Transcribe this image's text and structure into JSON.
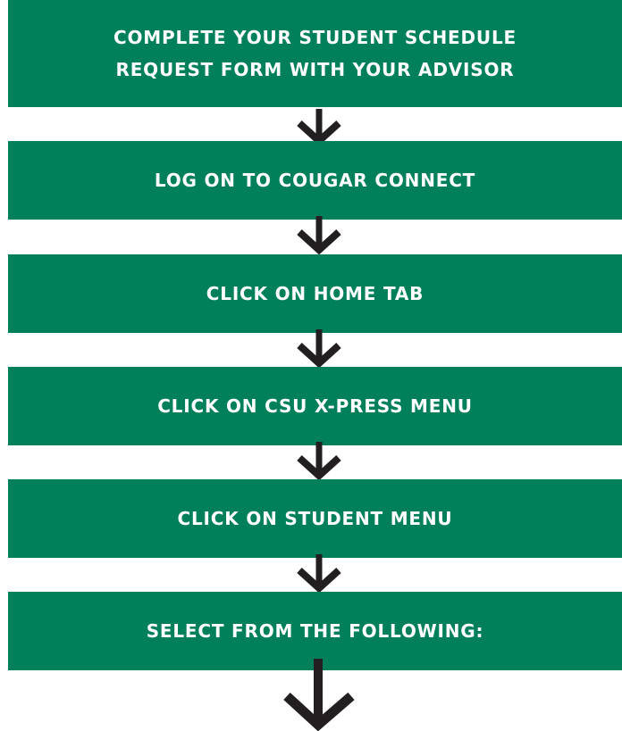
{
  "flowchart": {
    "steps": [
      {
        "label": "COMPLETE YOUR STUDENT SCHEDULE\nREQUEST FORM WITH YOUR ADVISOR"
      },
      {
        "label": "LOG ON TO COUGAR CONNECT"
      },
      {
        "label": "CLICK ON HOME TAB"
      },
      {
        "label": "CLICK ON CSU X-PRESS MENU"
      },
      {
        "label": "CLICK ON STUDENT MENU"
      },
      {
        "label": "SELECT FROM THE FOLLOWING:"
      }
    ]
  },
  "colors": {
    "box_fill": "#007f5b",
    "box_text": "#ffffff",
    "arrow": "#231f20"
  }
}
